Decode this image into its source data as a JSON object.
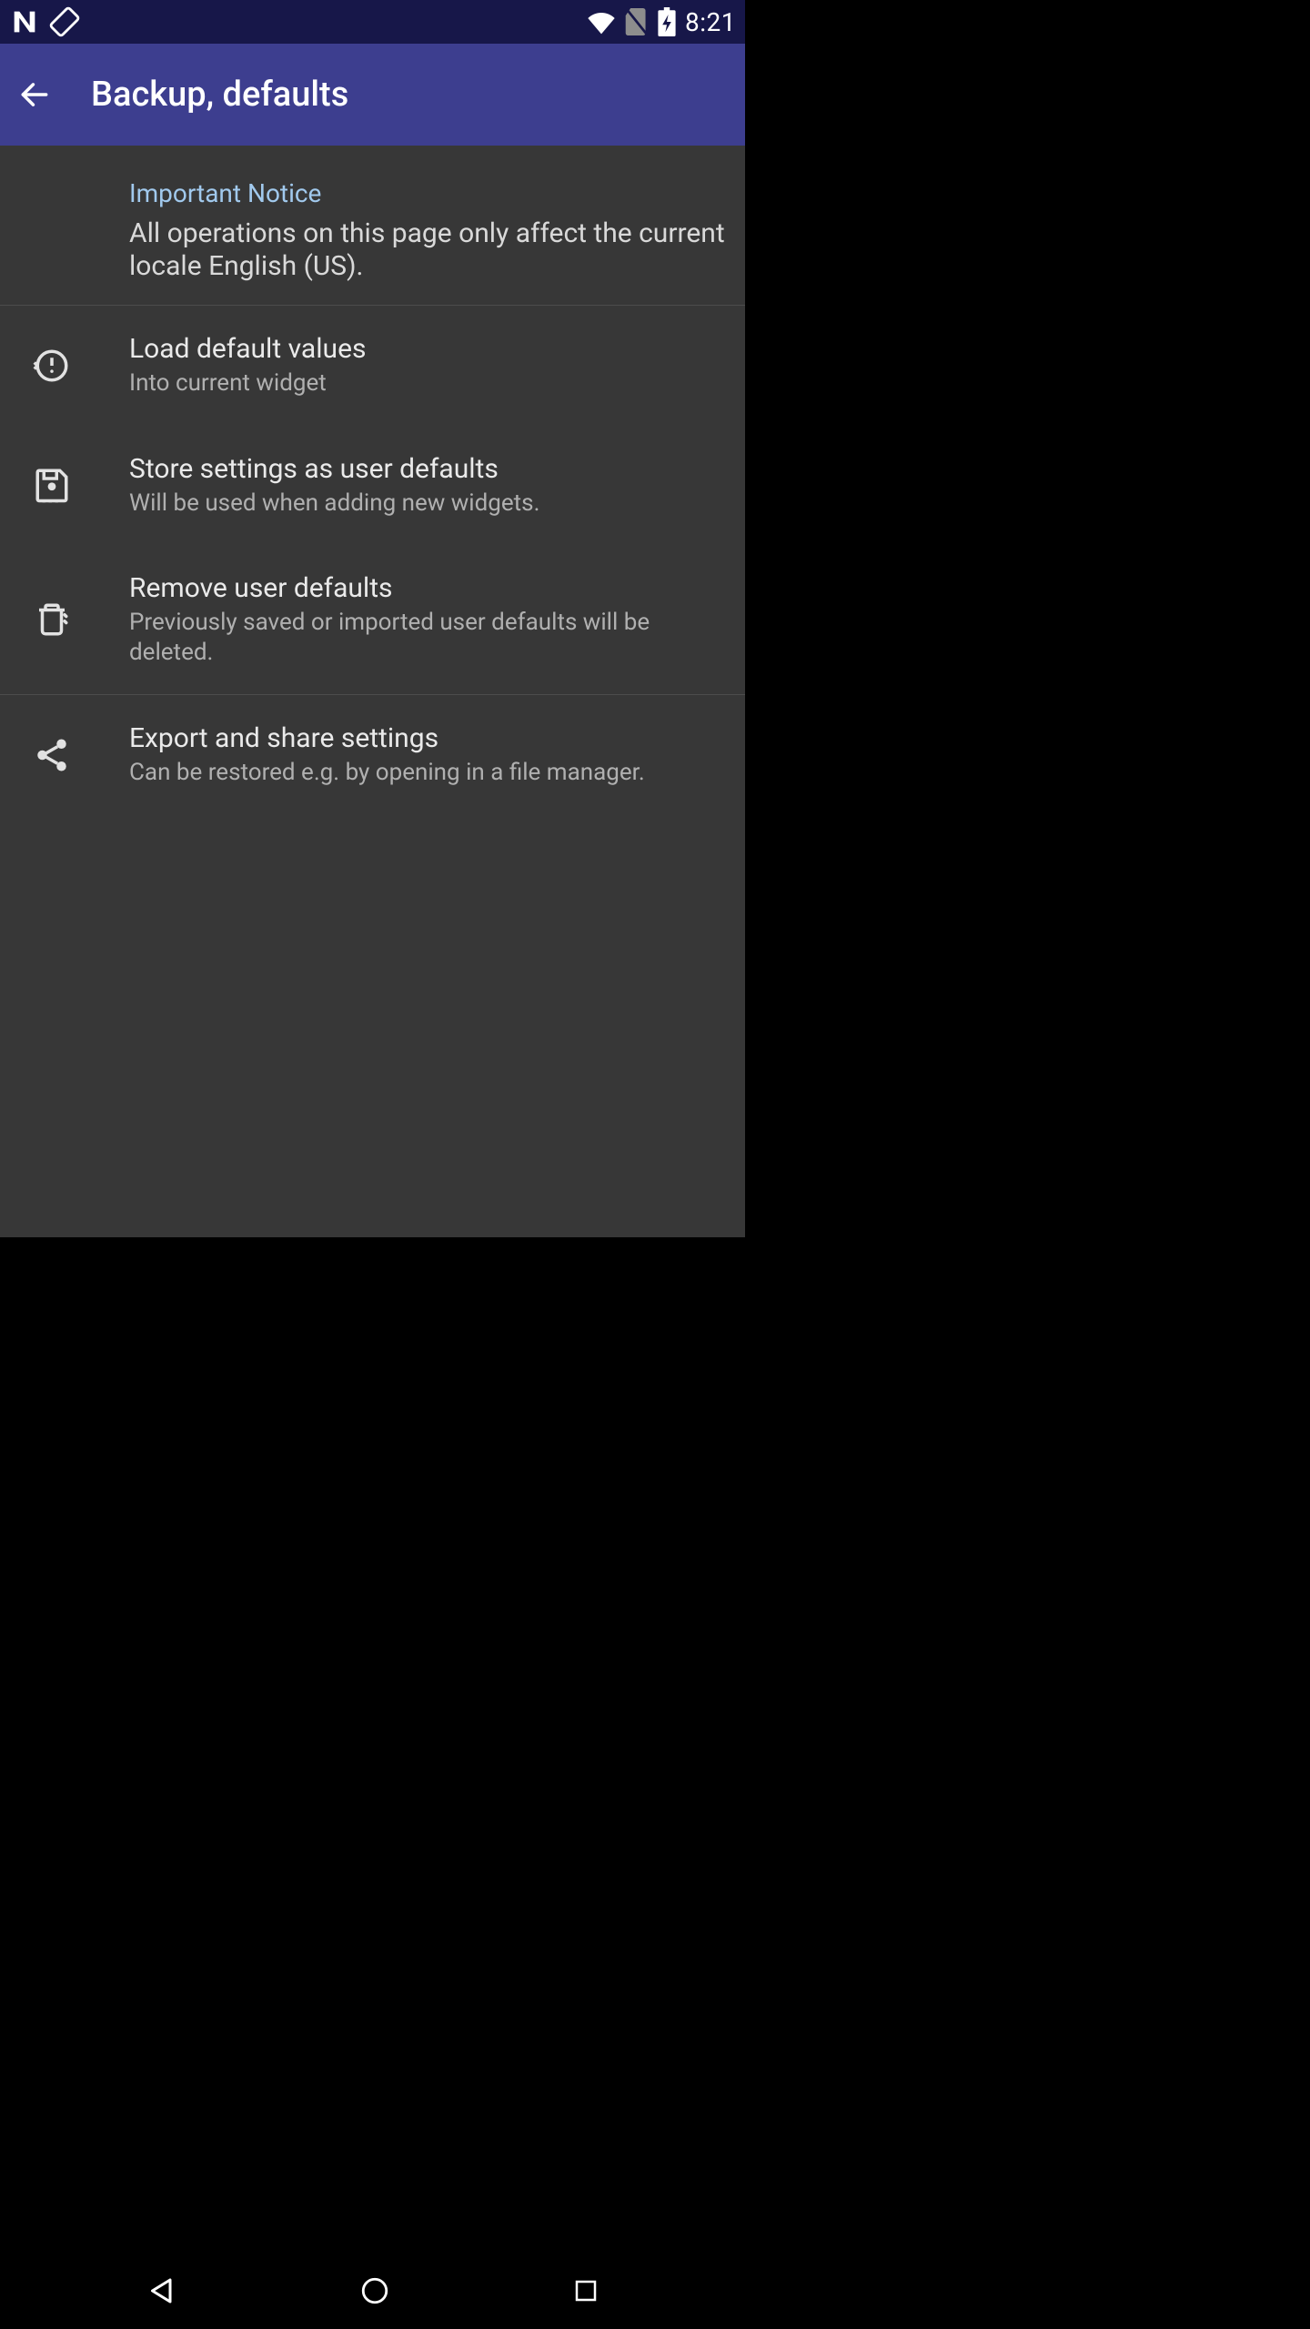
{
  "status": {
    "time": "8:21"
  },
  "header": {
    "title": "Backup, defaults"
  },
  "notice": {
    "title": "Important Notice",
    "text": "All operations on this page only affect the current locale English (US)."
  },
  "items": [
    {
      "icon": "restore-icon",
      "title": "Load default values",
      "subtitle": "Into current widget"
    },
    {
      "icon": "save-icon",
      "title": "Store settings as user defaults",
      "subtitle": "Will be used when adding new widgets."
    },
    {
      "icon": "trash-icon",
      "title": "Remove user defaults",
      "subtitle": "Previously saved or imported user defaults will be deleted."
    },
    {
      "icon": "share-icon",
      "title": "Export and share settings",
      "subtitle": "Can be restored e.g. by opening in a file manager."
    }
  ]
}
